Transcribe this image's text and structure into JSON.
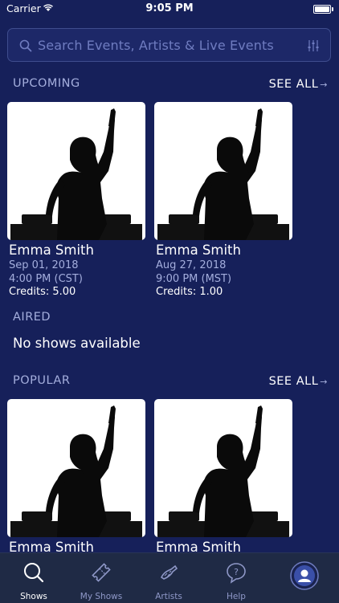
{
  "status": {
    "carrier": "Carrier",
    "time": "9:05 PM"
  },
  "search": {
    "placeholder": "Search Events, Artists & Live Events"
  },
  "upcoming": {
    "title": "UPCOMING",
    "see_all": "SEE ALL",
    "items": [
      {
        "name": "Emma Smith",
        "date": "Sep 01, 2018",
        "time": "4:00 PM (CST)",
        "credits": "Credits: 5.00"
      },
      {
        "name": "Emma Smith",
        "date": "Aug 27, 2018",
        "time": "9:00 PM (MST)",
        "credits": "Credits: 1.00"
      }
    ]
  },
  "aired": {
    "title": "AIRED",
    "empty": "No shows available"
  },
  "popular": {
    "title": "POPULAR",
    "see_all": "SEE ALL",
    "items": [
      {
        "name": "Emma Smith"
      },
      {
        "name": "Emma Smith"
      }
    ]
  },
  "tabs": [
    {
      "label": "Shows",
      "icon": "search-icon",
      "active": true
    },
    {
      "label": "My Shows",
      "icon": "ticket-icon",
      "active": false
    },
    {
      "label": "Artists",
      "icon": "artist-icon",
      "active": false
    },
    {
      "label": "Help",
      "icon": "help-icon",
      "active": false
    },
    {
      "label": "",
      "icon": "profile-icon",
      "active": false
    }
  ],
  "colors": {
    "background": "#16205a",
    "accent": "#a4aedd",
    "tabbar": "#1f2a45"
  }
}
